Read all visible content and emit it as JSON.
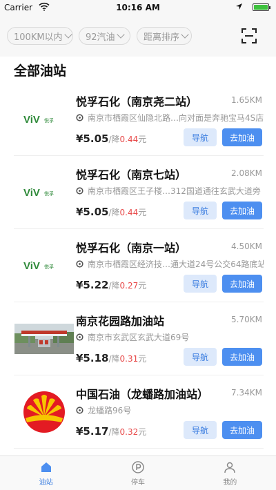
{
  "status": {
    "carrier": "Carrier",
    "time": "10:16 AM"
  },
  "filters": [
    {
      "label": "100KM以内"
    },
    {
      "label": "92汽油"
    },
    {
      "label": "距离排序"
    }
  ],
  "section_title": "全部油站",
  "stations": [
    {
      "name": "悦孚石化（南京尧二站）",
      "distance": "1.65KM",
      "address": "南京市栖霞区仙隐北路…向对面是奔驰宝马4S店",
      "price": "¥5.05",
      "cut_prefix": "/降",
      "cut": "0.44",
      "cut_unit": "元",
      "logo": "viv-logo",
      "logo_text": "ViV",
      "logo_sub": "悦孚",
      "nav_label": "导航",
      "go_label": "去加油"
    },
    {
      "name": "悦孚石化（南京七站）",
      "distance": "2.08KM",
      "address": "南京市栖霞区王子楼…312国道通往玄武大道旁",
      "price": "¥5.05",
      "cut_prefix": "/降",
      "cut": "0.44",
      "cut_unit": "元",
      "logo": "viv-logo",
      "logo_text": "ViV",
      "logo_sub": "悦孚",
      "nav_label": "导航",
      "go_label": "去加油"
    },
    {
      "name": "悦孚石化（南京一站）",
      "distance": "4.50KM",
      "address": "南京市栖霞区经济技…通大道24号公交64路底站",
      "price": "¥5.22",
      "cut_prefix": "/降",
      "cut": "0.27",
      "cut_unit": "元",
      "logo": "viv-logo",
      "logo_text": "ViV",
      "logo_sub": "悦孚",
      "nav_label": "导航",
      "go_label": "去加油"
    },
    {
      "name": "南京花园路加油站",
      "distance": "5.70KM",
      "address": "南京市玄武区玄武大道69号",
      "price": "¥5.18",
      "cut_prefix": "/降",
      "cut": "0.31",
      "cut_unit": "元",
      "logo": "station-photo",
      "nav_label": "导航",
      "go_label": "去加油"
    },
    {
      "name": "中国石油（龙蟠路加油站）",
      "distance": "7.34KM",
      "address": "龙蟠路96号",
      "price": "¥5.17",
      "cut_prefix": "/降",
      "cut": "0.32",
      "cut_unit": "元",
      "logo": "petrochina-logo",
      "nav_label": "导航",
      "go_label": "去加油"
    }
  ],
  "tabs": [
    {
      "label": "油站",
      "icon": "home-icon",
      "active": true
    },
    {
      "label": "停车",
      "icon": "parking-icon",
      "active": false
    },
    {
      "label": "我的",
      "icon": "user-icon",
      "active": false
    }
  ],
  "colors": {
    "accent": "#4d8ff0",
    "discount": "#e84b4b"
  }
}
